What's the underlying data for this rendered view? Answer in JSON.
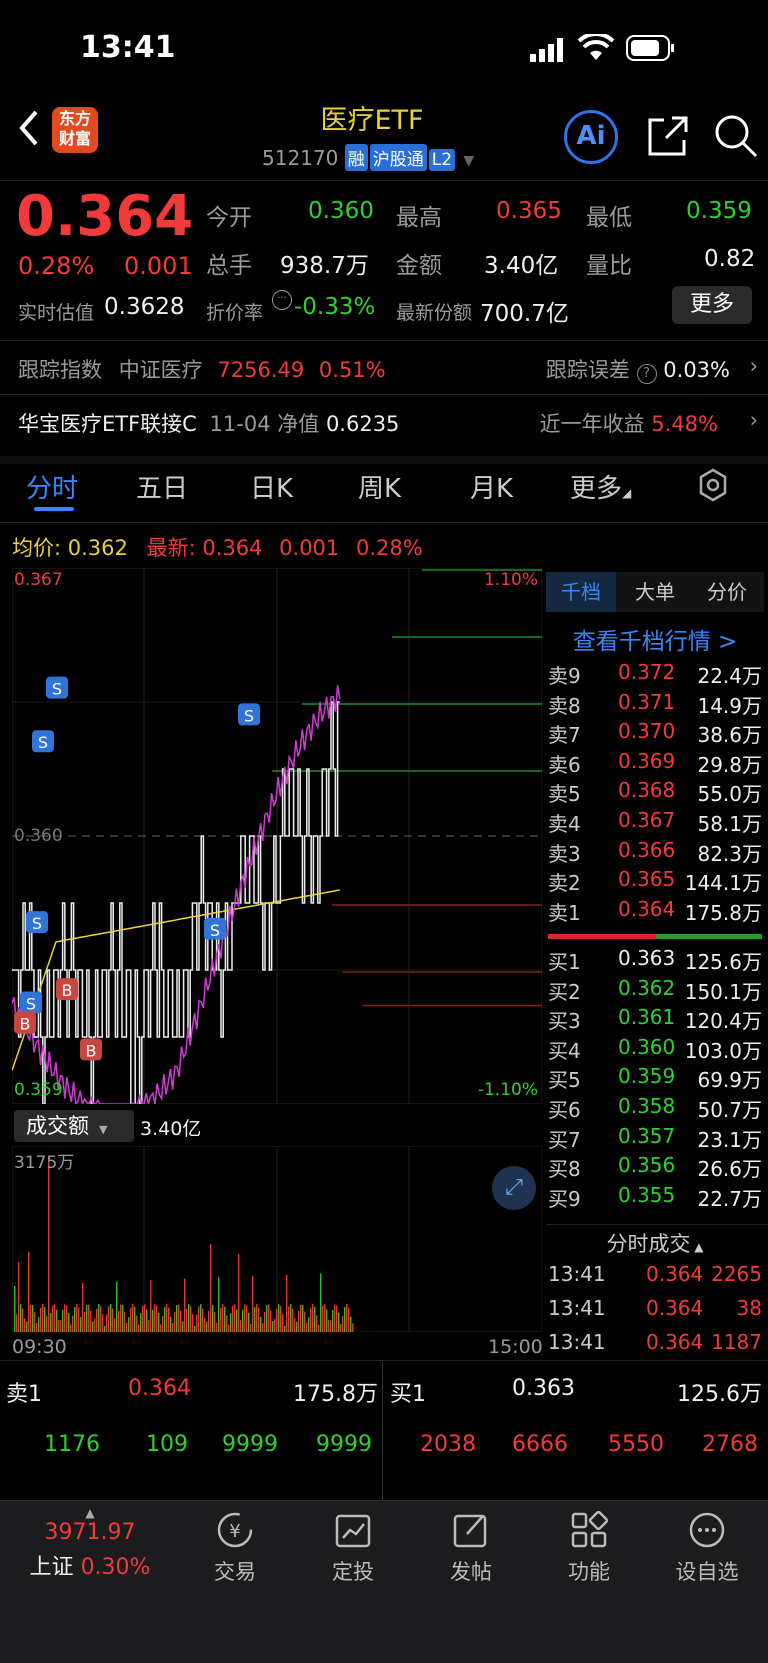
{
  "status_bar": {
    "time": "13:41"
  },
  "header": {
    "back_icon": "chevron-left-icon",
    "logo_text_line1": "东方",
    "logo_text_line2": "财富",
    "title": "医疗ETF",
    "code": "512170",
    "tags": [
      "融",
      "沪股通",
      "L2"
    ],
    "ai_label": "Ai",
    "share_icon": "share-icon",
    "search_icon": "search-icon"
  },
  "quote": {
    "price": "0.364",
    "change_pct": "0.28%",
    "change": "0.001",
    "open_label": "今开",
    "open": "0.360",
    "high_label": "最高",
    "high": "0.365",
    "low_label": "最低",
    "low": "0.359",
    "volume_label": "总手",
    "volume": "938.7万",
    "amount_label": "金额",
    "amount": "3.40亿",
    "ratio_label": "量比",
    "ratio": "0.82",
    "iopv_label": "实时估值",
    "iopv": "0.3628",
    "premium_label": "折价率",
    "premium": "-0.33%",
    "shares_label": "最新份额",
    "shares": "700.7亿",
    "more_button": "更多"
  },
  "tracking": {
    "label": "跟踪指数",
    "index_name": "中证医疗",
    "index_value": "7256.49",
    "index_pct": "0.51%",
    "error_label": "跟踪误差",
    "error_value": "0.03%"
  },
  "linked_fund": {
    "name": "华宝医疗ETF联接C",
    "date": "11-04",
    "nav_label": "净值",
    "nav": "0.6235",
    "return_label": "近一年收益",
    "return_value": "5.48%"
  },
  "chart_tabs": [
    "分时",
    "五日",
    "日K",
    "周K",
    "月K",
    "更多"
  ],
  "chart_header": {
    "avg_label": "均价:",
    "avg": "0.362",
    "last_label": "最新:",
    "last": "0.364",
    "last_change": "0.001",
    "last_pct": "0.28%"
  },
  "chart_data": {
    "type": "line",
    "y_top": "0.367",
    "y_bottom": "0.359",
    "y_mid": "0.360",
    "pct_top": "1.10%",
    "pct_bottom": "-1.10%",
    "ylim": [
      0.359,
      0.367
    ],
    "x_start": "09:30",
    "x_end": "15:00",
    "volume_label": "成交额",
    "volume_value": "3.40亿",
    "volume_max": "3175万"
  },
  "order_tabs": [
    "千档",
    "大单",
    "分价"
  ],
  "order_link": "查看千档行情 >",
  "asks": [
    {
      "label": "卖9",
      "price": "0.372",
      "vol": "22.4万"
    },
    {
      "label": "卖8",
      "price": "0.371",
      "vol": "14.9万"
    },
    {
      "label": "卖7",
      "price": "0.370",
      "vol": "38.6万"
    },
    {
      "label": "卖6",
      "price": "0.369",
      "vol": "29.8万"
    },
    {
      "label": "卖5",
      "price": "0.368",
      "vol": "55.0万"
    },
    {
      "label": "卖4",
      "price": "0.367",
      "vol": "58.1万"
    },
    {
      "label": "卖3",
      "price": "0.366",
      "vol": "82.3万"
    },
    {
      "label": "卖2",
      "price": "0.365",
      "vol": "144.1万"
    },
    {
      "label": "卖1",
      "price": "0.364",
      "vol": "175.8万"
    }
  ],
  "bids": [
    {
      "label": "买1",
      "price": "0.363",
      "vol": "125.6万"
    },
    {
      "label": "买2",
      "price": "0.362",
      "vol": "150.1万"
    },
    {
      "label": "买3",
      "price": "0.361",
      "vol": "120.4万"
    },
    {
      "label": "买4",
      "price": "0.360",
      "vol": "103.0万"
    },
    {
      "label": "买5",
      "price": "0.359",
      "vol": "69.9万"
    },
    {
      "label": "买6",
      "price": "0.358",
      "vol": "50.7万"
    },
    {
      "label": "买7",
      "price": "0.357",
      "vol": "23.1万"
    },
    {
      "label": "买8",
      "price": "0.356",
      "vol": "26.6万"
    },
    {
      "label": "买9",
      "price": "0.355",
      "vol": "22.7万"
    }
  ],
  "ticks_title": "分时成交",
  "ticks": [
    {
      "time": "13:41",
      "price": "0.364",
      "vol": "2265"
    },
    {
      "time": "13:41",
      "price": "0.364",
      "vol": "38"
    },
    {
      "time": "13:41",
      "price": "0.364",
      "vol": "1187"
    }
  ],
  "bottom_quote": {
    "sell_label": "卖1",
    "sell_price": "0.364",
    "sell_vol": "175.8万",
    "buy_label": "买1",
    "buy_price": "0.363",
    "buy_vol": "125.6万",
    "sell_queue": [
      "1176",
      "109",
      "9999",
      "9999"
    ],
    "buy_queue": [
      "2038",
      "6666",
      "5550",
      "2768"
    ]
  },
  "tab_bar": {
    "index_value": "3971.97",
    "index_name": "上证",
    "index_pct": "0.30%",
    "items": [
      "交易",
      "定投",
      "发帖",
      "功能",
      "设自选"
    ]
  }
}
